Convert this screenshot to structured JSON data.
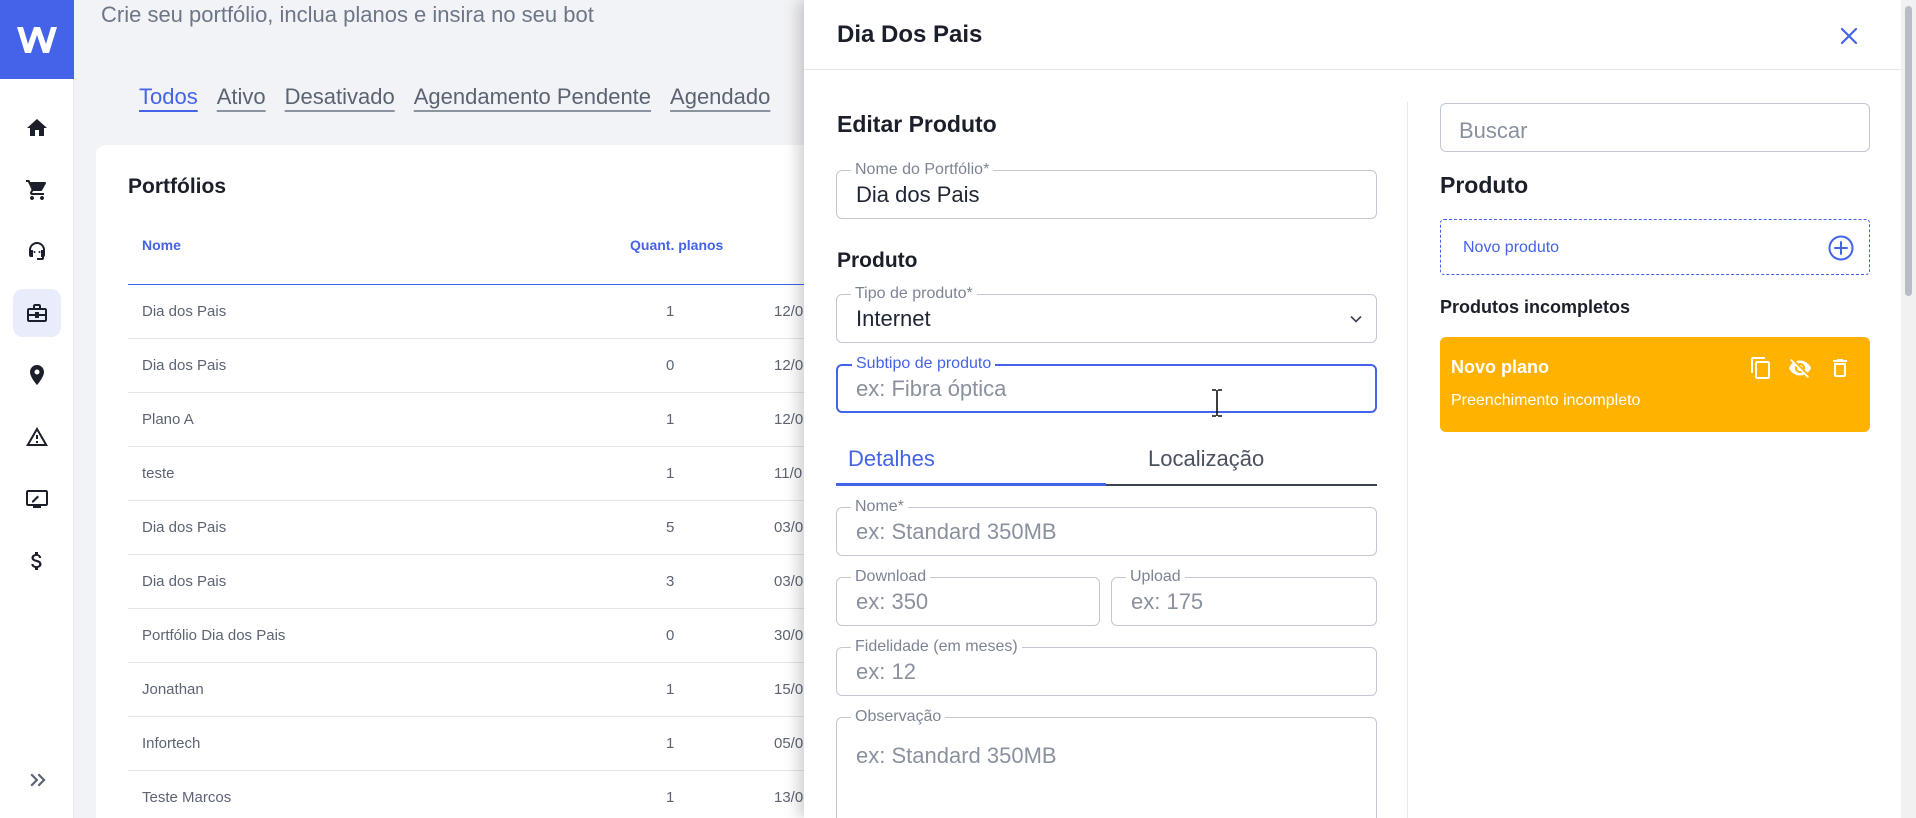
{
  "app": {
    "subtitle": "Crie seu portfólio, inclua planos e insira no seu bot",
    "brand_color": "#4463e8"
  },
  "sidenav": {
    "items": [
      {
        "icon": "home-icon"
      },
      {
        "icon": "cart-icon"
      },
      {
        "icon": "support-agent-icon"
      },
      {
        "icon": "briefcase-icon",
        "active": true
      },
      {
        "icon": "location-pin-icon"
      },
      {
        "icon": "warning-icon"
      },
      {
        "icon": "edit-screen-icon"
      },
      {
        "icon": "dollar-icon"
      }
    ],
    "expand_icon": "double-chevron-right-icon"
  },
  "filters": {
    "tabs": [
      "Todos",
      "Ativo",
      "Desativado",
      "Agendamento Pendente",
      "Agendado"
    ],
    "active": "Todos"
  },
  "portfolios": {
    "title": "Portfólios",
    "columns": [
      "Nome",
      "Quant. planos"
    ],
    "rows": [
      {
        "name": "Dia dos Pais",
        "plans": "1",
        "date": "12/0"
      },
      {
        "name": "Dia dos Pais",
        "plans": "0",
        "date": "12/0"
      },
      {
        "name": "Plano A",
        "plans": "1",
        "date": "12/0"
      },
      {
        "name": "teste",
        "plans": "1",
        "date": "11/0"
      },
      {
        "name": "Dia dos Pais",
        "plans": "5",
        "date": "03/0"
      },
      {
        "name": "Dia dos Pais",
        "plans": "3",
        "date": "03/0"
      },
      {
        "name": "Portfólio Dia dos Pais",
        "plans": "0",
        "date": "30/0"
      },
      {
        "name": "Jonathan",
        "plans": "1",
        "date": "15/0"
      },
      {
        "name": "Infortech",
        "plans": "1",
        "date": "05/0"
      },
      {
        "name": "Teste Marcos",
        "plans": "1",
        "date": "13/0"
      }
    ]
  },
  "drawer": {
    "title": "Dia Dos Pais",
    "edit_title": "Editar Produto",
    "portfolio_name": {
      "label": "Nome do Portfólio*",
      "value": "Dia dos Pais"
    },
    "product_section": "Produto",
    "product_type": {
      "label": "Tipo de produto*",
      "value": "Internet"
    },
    "product_subtype": {
      "label": "Subtipo de produto",
      "placeholder": "ex: Fibra óptica"
    },
    "tabs": [
      "Detalhes",
      "Localização"
    ],
    "active_tab": "Detalhes",
    "name": {
      "label": "Nome*",
      "placeholder": "ex: Standard 350MB"
    },
    "download": {
      "label": "Download",
      "placeholder": "ex: 350"
    },
    "upload": {
      "label": "Upload",
      "placeholder": "ex: 175"
    },
    "fidelity": {
      "label": "Fidelidade (em meses)",
      "placeholder": "ex: 12"
    },
    "observation": {
      "label": "Observação",
      "placeholder": "ex: Standard 350MB"
    },
    "right": {
      "search_placeholder": "Buscar",
      "product_title": "Produto",
      "new_product": "Novo produto",
      "incomplete_title": "Produtos incompletos",
      "incomplete_card": {
        "title": "Novo plano",
        "status": "Preenchimento incompleto",
        "color": "#ffb200",
        "icons": [
          "copy-icon",
          "visibility-off-icon",
          "trash-icon"
        ]
      }
    }
  }
}
